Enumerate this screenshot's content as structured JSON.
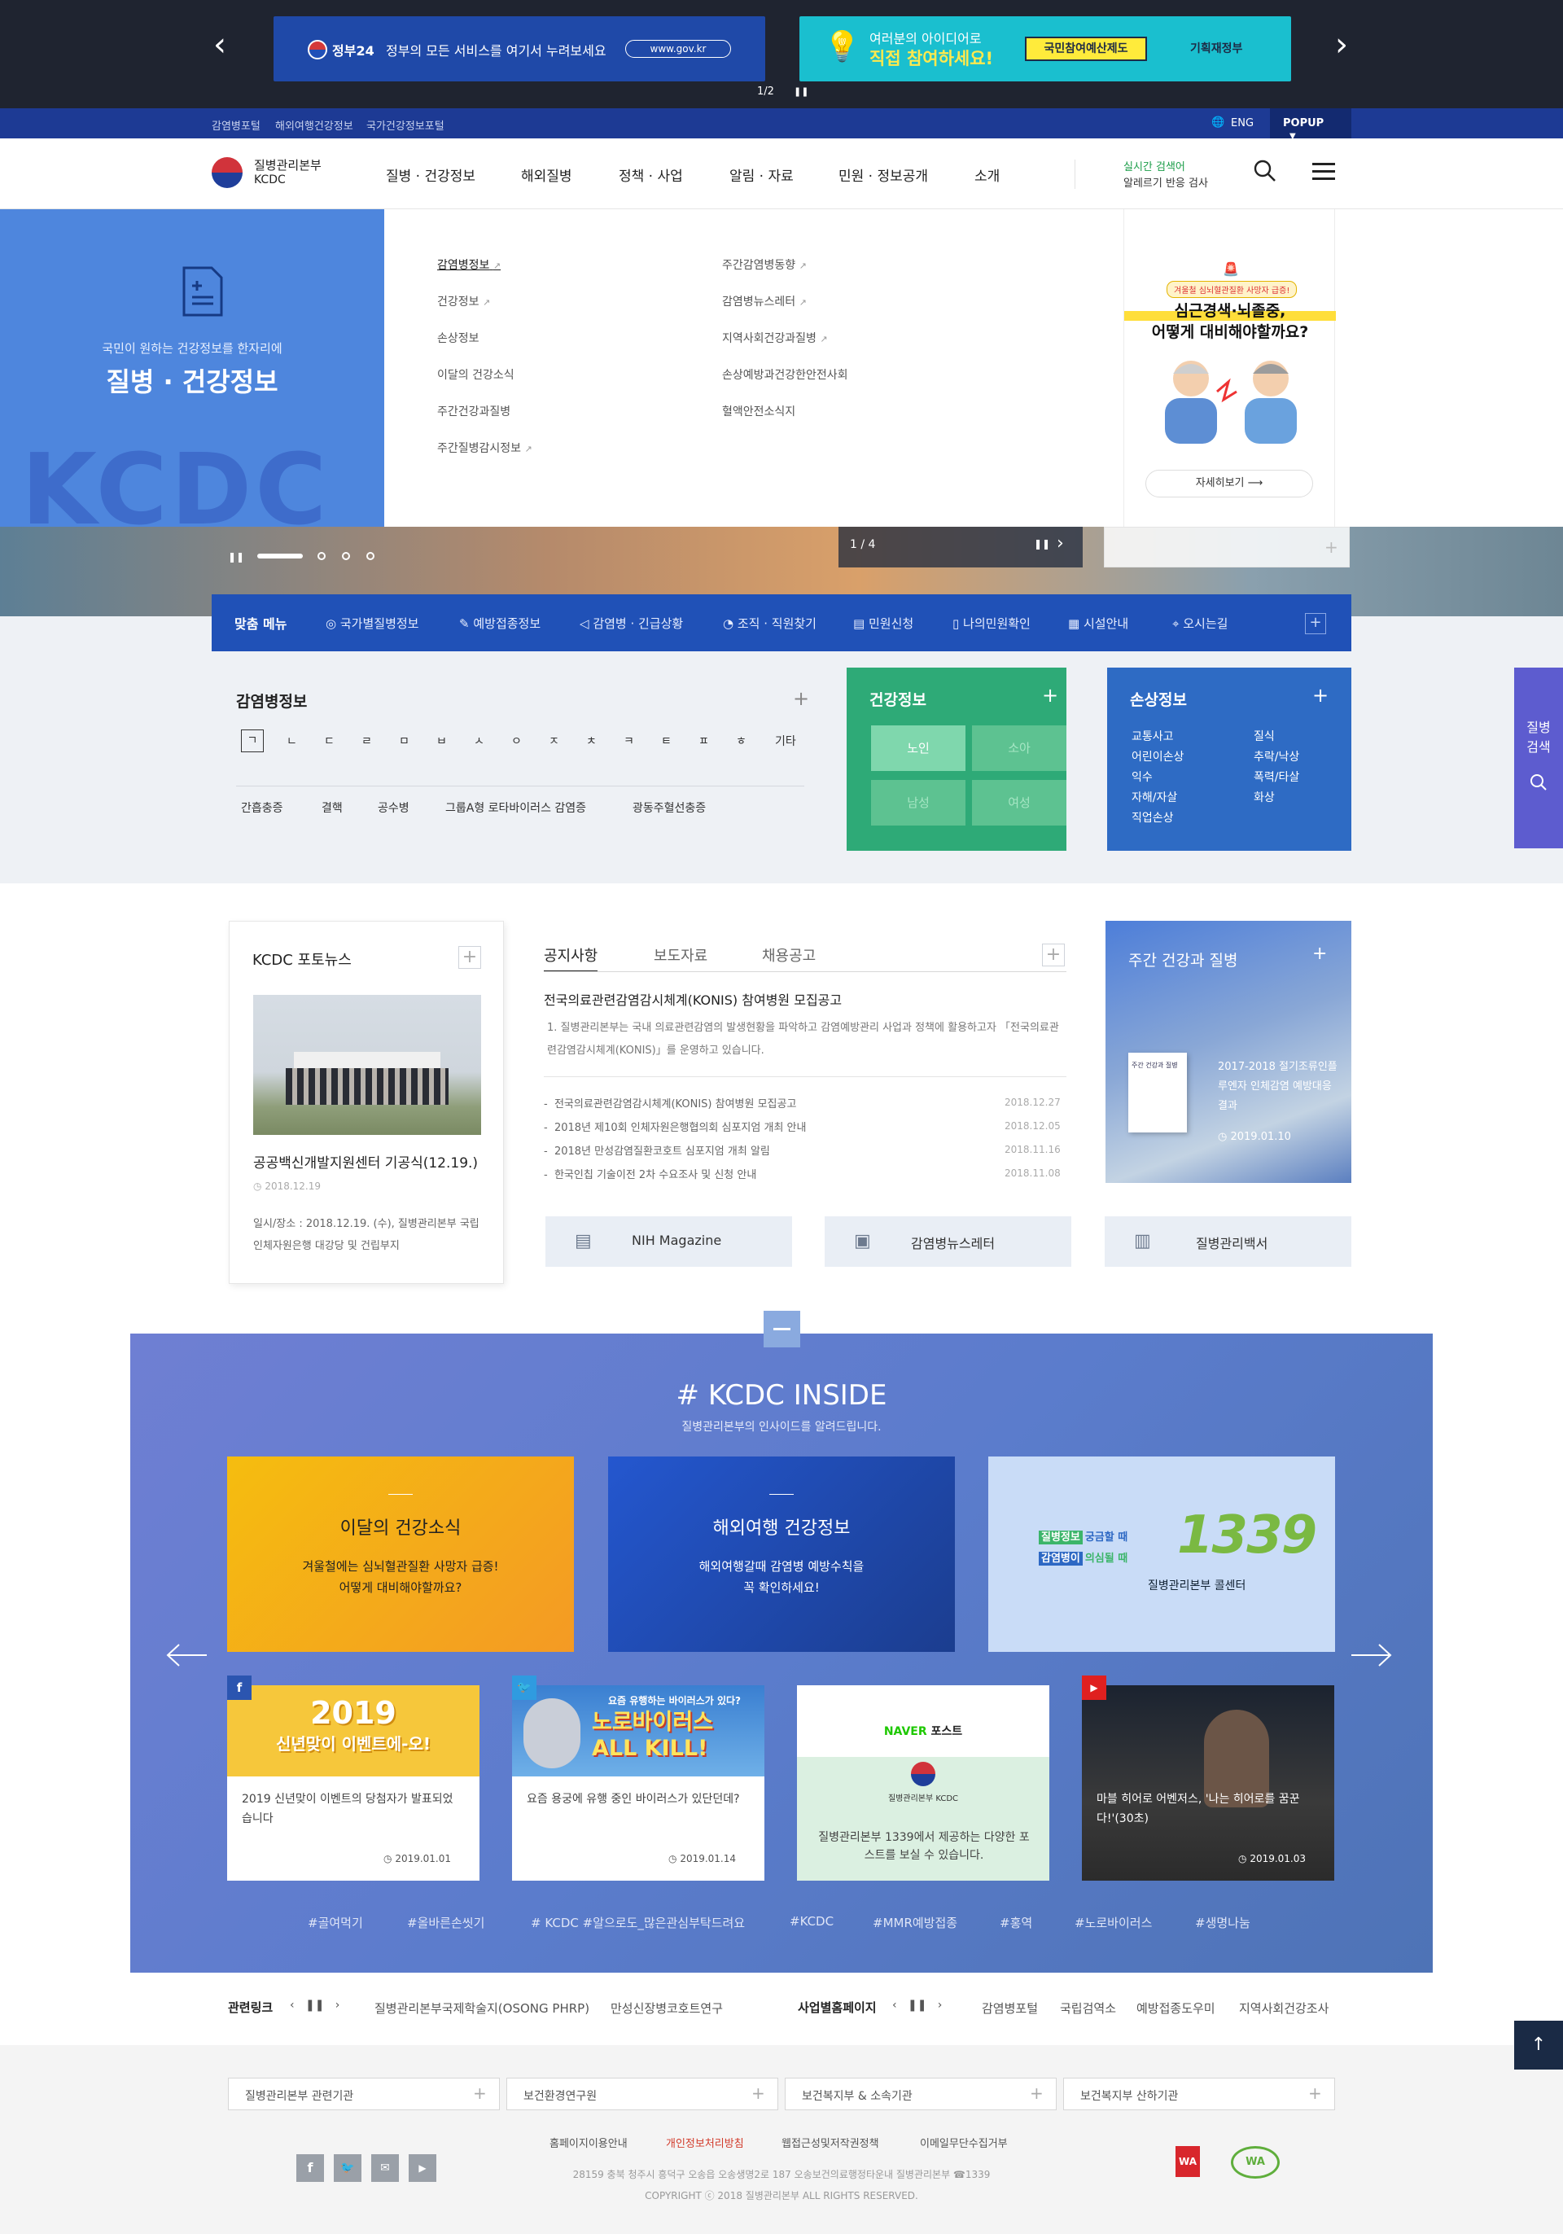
{
  "top_banner": {
    "prev_icon": "chevron-left-icon",
    "next_icon": "chevron-right-icon",
    "banner1_logo": "정부24",
    "banner1_text": "정부의 모든 서비스를 여기서 누려보세요",
    "banner1_url": "www.gov.kr",
    "banner2_text1": "여러분의 아이디어로",
    "banner2_text2": "직접 참여하세요!",
    "banner2_box": "국민참여예산제도",
    "banner2_org": "기획재정부",
    "pager": "1/2"
  },
  "util": {
    "links": [
      "감염병포털",
      "해외여행건강정보",
      "국가건강정보포털"
    ],
    "lang": "ENG",
    "popup": "POPUP"
  },
  "header": {
    "logo_kr": "질병관리본부",
    "logo_en": "KCDC",
    "gnb": [
      "질병 · 건강정보",
      "해외질병",
      "정책 · 사업",
      "알림 · 자료",
      "민원 · 정보공개",
      "소개"
    ],
    "realtime_label": "실시간 검색어",
    "realtime_value": "알레르기 반응 검사"
  },
  "mega": {
    "sub": "국민이 원하는 건강정보를 한자리에",
    "title": "질병 · 건강정보",
    "bg_text": "KCDC",
    "col1": [
      "감염병정보",
      "건강정보",
      "손상정보",
      "이달의 건강소식",
      "주간건강과질병",
      "주간질병감시정보"
    ],
    "col2": [
      "주간감염병동향",
      "감염병뉴스레터",
      "지역사회건강과질병",
      "손상예방과건강한안전사회",
      "혈액안전소식지"
    ],
    "promo_tag": "겨울철 심뇌혈관질환 사망자 급증!",
    "promo_title1": "심근경색·뇌졸중,",
    "promo_title2": "어떻게 대비해야할까요?",
    "promo_btn": "자세히보기"
  },
  "hero": {
    "pager": "1 / 4"
  },
  "quick": {
    "title": "맞춤 메뉴",
    "items": [
      "국가별질병정보",
      "예방접종정보",
      "감염병 · 긴급상황",
      "조직 · 직원찾기",
      "민원신청",
      "나의민원확인",
      "시설안내",
      "오시는길"
    ]
  },
  "disease": {
    "title": "감염병정보",
    "consonants": [
      "ㄱ",
      "ㄴ",
      "ㄷ",
      "ㄹ",
      "ㅁ",
      "ㅂ",
      "ㅅ",
      "ㅇ",
      "ㅈ",
      "ㅊ",
      "ㅋ",
      "ㅌ",
      "ㅍ",
      "ㅎ",
      "기타"
    ],
    "list": [
      "간흡충증",
      "결핵",
      "공수병",
      "그룹A형 로타바이러스 감염증",
      "광동주혈선충증"
    ]
  },
  "health": {
    "title": "건강정보",
    "buttons": [
      "노인",
      "소아",
      "남성",
      "여성"
    ]
  },
  "injury": {
    "title": "손상정보",
    "col1": [
      "교통사고",
      "어린이손상",
      "익수",
      "자해/자살",
      "직업손상"
    ],
    "col2": [
      "질식",
      "추락/낙상",
      "폭력/타살",
      "화상"
    ]
  },
  "side_search": {
    "line1": "질병",
    "line2": "검색"
  },
  "photo_news": {
    "title": "KCDC 포토뉴스",
    "headline": "공공백신개발지원센터 기공식(12.19.)",
    "date": "2018.12.19",
    "desc": "일시/장소 : 2018.12.19. (수), 질병관리본부 국립인체자원은행 대강당 및 건립부지"
  },
  "notice": {
    "tabs": [
      "공지사항",
      "보도자료",
      "채용공고"
    ],
    "head_title": "전국의료관련감염감시체계(KONIS) 참여병원 모집공고",
    "head_desc": "1. 질병관리본부는 국내 의료관련감염의 발생현황을 파악하고 감염예방관리 사업과 정책에 활용하고자 「전국의료관련감염감시체계(KONIS)」를 운영하고 있습니다.",
    "items": [
      {
        "t": "전국의료관련감염감시체계(KONIS) 참여병원 모집공고",
        "d": "2018.12.27"
      },
      {
        "t": "2018년 제10회 인체자원은행협의회 심포지엄 개최 안내",
        "d": "2018.12.05"
      },
      {
        "t": "2018년 만성감염질환코호트 심포지엄 개최 알림",
        "d": "2018.11.16"
      },
      {
        "t": "한국인칩 기술이전 2차 수요조사 및 신청 안내",
        "d": "2018.11.08"
      }
    ]
  },
  "weekly": {
    "title": "주간 건강과 질병",
    "book_title": "주간 건강과 질병",
    "desc": "2017-2018 절기조류인플루엔자 인체감염 예방대응결과",
    "date": "2019.01.10"
  },
  "shortcuts": [
    "NIH Magazine",
    "감염병뉴스레터",
    "질병관리백서"
  ],
  "inside": {
    "title": "# KCDC INSIDE",
    "sub": "질병관리본부의 인사이드를 알려드립니다.",
    "card1_title": "이달의 건강소식",
    "card1_desc1": "겨울철에는 심뇌혈관질환 사망자 급증!",
    "card1_desc2": "어떻게 대비해야할까요?",
    "card2_title": "해외여행 건강정보",
    "card2_desc1": "해외여행갈때 감염병 예방수칙을",
    "card2_desc2": "꼭 확인하세요!",
    "card3_l1a": "질병정보",
    "card3_l1b": "궁금할 때",
    "card3_l2a": "감염병이",
    "card3_l2b": "의심될 때",
    "card3_num": "1339",
    "card3_sub": "질병관리본부 콜센터",
    "sns": [
      {
        "img1": "2019",
        "img2": "신년맞이 이벤트에-오!",
        "t": "2019 신년맞이 이벤트의 당첨자가 발표되었습니다",
        "d": "2019.01.01"
      },
      {
        "img1": "요즘 유행하는 바이러스가 있다?",
        "img2": "노로바이러스 ALL KILL!",
        "t": "요즘 용궁에 유행 중인 바이러스가 있단던데?",
        "d": "2019.01.14"
      },
      {
        "img1": "포스트",
        "img2": "질병관리본부 KCDC",
        "t": "질병관리본부 1339에서 제공하는 다양한 포스트를 보실 수 있습니다.",
        "d": ""
      },
      {
        "img1": "",
        "img2": "",
        "t": "마블 히어로 어벤저스, '나는 히어로를 꿈꾼다!'(30초)",
        "d": "2019.01.03"
      }
    ],
    "brand_naver": "NAVER",
    "tags": [
      "#골여먹기",
      "#올바른손씻기",
      "# KCDC #알으로도_많은관심부탁드려요",
      "#KCDC",
      "#MMR예방접종",
      "#홍역",
      "#노로바이러스",
      "#생명나눔"
    ]
  },
  "related": {
    "label": "관련링크",
    "links": [
      "질병관리본부국제학술지(OSONG PHRP)",
      "만성신장병코호트연구"
    ],
    "label2": "사업별홈페이지",
    "links2": [
      "감염병포털",
      "국립검역소",
      "예방접종도우미",
      "지역사회건강조사"
    ]
  },
  "footer": {
    "selects": [
      "질병관리본부 관련기관",
      "보건환경연구원",
      "보건복지부 & 소속기관",
      "보건복지부 산하기관"
    ],
    "links": [
      "홈페이지이용안내",
      "개인정보처리방침",
      "웹접근성및저작권정책",
      "이메일무단수집거부"
    ],
    "address": "28159 충북 청주시 흥덕구 오송읍 오송생명2로 187 오송보건의료행정타운내 질병관리본부 ☎1339",
    "copyright": "COPYRIGHT ⓒ 2018 질병관리본부 ALL RIGHTS RESERVED."
  },
  "colors": {
    "primary": "#2051b7",
    "health": "#2eaa77",
    "injury": "#2e6bc4",
    "side": "#5d5ccf"
  }
}
